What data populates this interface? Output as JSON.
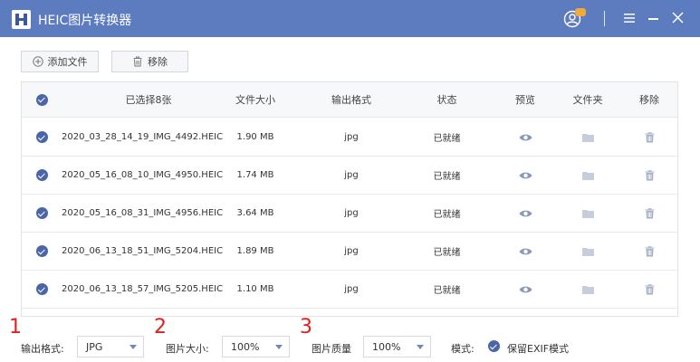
{
  "app": {
    "title": "HEIC图片转换器"
  },
  "toolbar": {
    "add_label": "添加文件",
    "remove_label": "移除"
  },
  "table": {
    "headers": {
      "selected": "已选择8张",
      "size": "文件大小",
      "format": "输出格式",
      "status": "状态",
      "preview": "预览",
      "folder": "文件夹",
      "remove": "移除"
    },
    "rows": [
      {
        "name": "2020_03_28_14_19_IMG_4492.HEIC",
        "size": "1.90 MB",
        "format": "jpg",
        "status": "已就绪"
      },
      {
        "name": "2020_05_16_08_10_IMG_4950.HEIC",
        "size": "1.74 MB",
        "format": "jpg",
        "status": "已就绪"
      },
      {
        "name": "2020_05_16_08_31_IMG_4956.HEIC",
        "size": "3.64 MB",
        "format": "jpg",
        "status": "已就绪"
      },
      {
        "name": "2020_06_13_18_51_IMG_5204.HEIC",
        "size": "1.89 MB",
        "format": "jpg",
        "status": "已就绪"
      },
      {
        "name": "2020_06_13_18_57_IMG_5205.HEIC",
        "size": "1.10 MB",
        "format": "jpg",
        "status": "已就绪"
      }
    ]
  },
  "footer": {
    "markers": [
      "1",
      "2",
      "3"
    ],
    "output_format_label": "输出格式:",
    "output_format_value": "JPG",
    "image_size_label": "图片大小:",
    "image_size_value": "100%",
    "quality_label": "图片质量",
    "quality_value": "100%",
    "mode_label": "模式:",
    "exif_label": "保留EXIF模式"
  },
  "colors": {
    "titlebar": "#5d7bbf",
    "accent": "#4a66a8",
    "marker": "#e0201d"
  }
}
